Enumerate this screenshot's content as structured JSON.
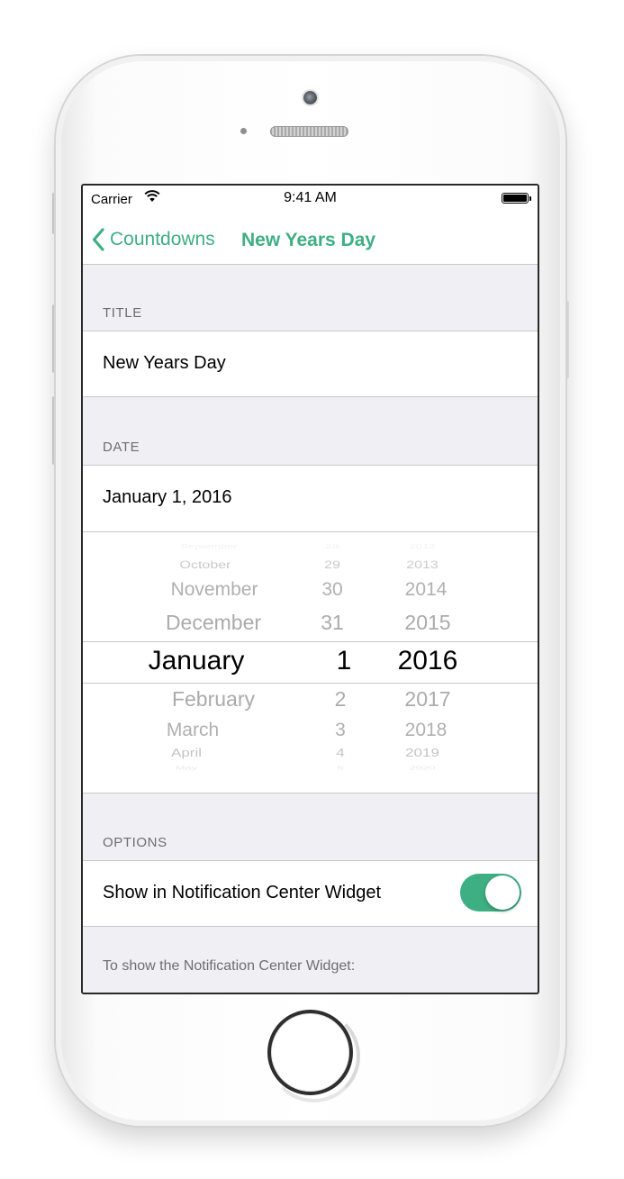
{
  "colors": {
    "accent": "#3eaf82",
    "background": "#efeff4",
    "header_text": "#6d6d72"
  },
  "status_bar": {
    "carrier": "Carrier",
    "time": "9:41 AM",
    "wifi_icon": "wifi-icon",
    "battery_icon": "battery-icon"
  },
  "nav": {
    "back_label": "Countdowns",
    "back_icon": "chevron-left-icon",
    "title": "New Years Day"
  },
  "sections": {
    "title": {
      "header": "TITLE",
      "value": "New Years Day"
    },
    "date": {
      "header": "DATE",
      "value": "January 1, 2016"
    },
    "options": {
      "header": "OPTIONS",
      "toggle_label": "Show in Notification Center Widget",
      "toggle_on": true
    },
    "footer": "To show the Notification Center Widget:"
  },
  "date_picker": {
    "months": [
      "September",
      "October",
      "November",
      "December",
      "January",
      "February",
      "March",
      "April",
      "May"
    ],
    "days": [
      "28",
      "29",
      "30",
      "31",
      "1",
      "2",
      "3",
      "4",
      "5"
    ],
    "years": [
      "2012",
      "2013",
      "2014",
      "2015",
      "2016",
      "2017",
      "2018",
      "2019",
      "2020"
    ],
    "selected": {
      "month": "January",
      "day": "1",
      "year": "2016"
    }
  }
}
